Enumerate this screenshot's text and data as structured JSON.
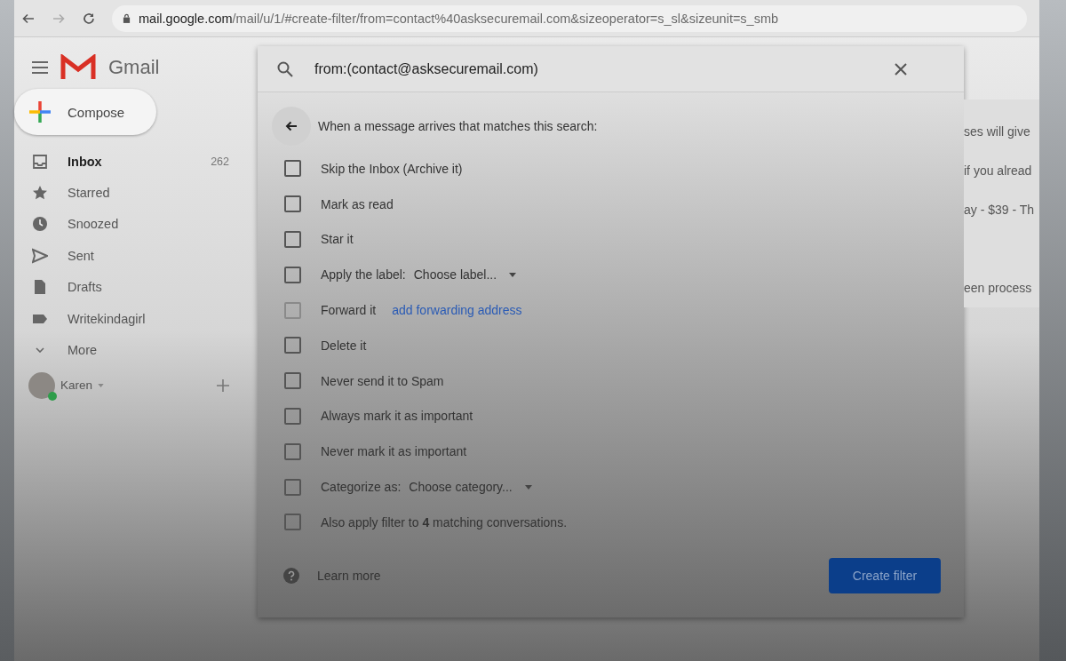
{
  "browser": {
    "url_host": "mail.google.com",
    "url_path": "/mail/u/1/#create-filter/from=contact%40asksecuremail.com&sizeoperator=s_sl&sizeunit=s_smb"
  },
  "header": {
    "app_name": "Gmail"
  },
  "search": {
    "value": "from:(contact@asksecuremail.com)"
  },
  "sidebar": {
    "compose": "Compose",
    "items": [
      {
        "label": "Inbox",
        "count": "262",
        "selected": true
      },
      {
        "label": "Starred",
        "selected": false
      },
      {
        "label": "Snoozed",
        "selected": false
      },
      {
        "label": "Sent",
        "selected": false
      },
      {
        "label": "Drafts",
        "selected": false
      },
      {
        "label": "Writekindagirl",
        "selected": false
      },
      {
        "label": "More",
        "selected": false
      }
    ],
    "account": {
      "name": "Karen"
    }
  },
  "background_snippets": [
    "ses will give",
    "if you alread",
    "ay - $39 - Th",
    "een process"
  ],
  "filter": {
    "heading": "When a message arrives that matches this search:",
    "options": [
      {
        "kind": "plain",
        "label": "Skip the Inbox (Archive it)",
        "checked": false,
        "disabled": false
      },
      {
        "kind": "plain",
        "label": "Mark as read",
        "checked": false,
        "disabled": false
      },
      {
        "kind": "plain",
        "label": "Star it",
        "checked": false,
        "disabled": false
      },
      {
        "kind": "dropdown",
        "label": "Apply the label:",
        "value": "Choose label...",
        "checked": false,
        "disabled": false
      },
      {
        "kind": "link",
        "label": "Forward it",
        "link": "add forwarding address",
        "checked": false,
        "disabled": true
      },
      {
        "kind": "plain",
        "label": "Delete it",
        "checked": false,
        "disabled": false
      },
      {
        "kind": "plain",
        "label": "Never send it to Spam",
        "checked": false,
        "disabled": false
      },
      {
        "kind": "plain",
        "label": "Always mark it as important",
        "checked": false,
        "disabled": false
      },
      {
        "kind": "plain",
        "label": "Never mark it as important",
        "checked": false,
        "disabled": false
      },
      {
        "kind": "dropdown",
        "label": "Categorize as:",
        "value": "Choose category...",
        "checked": false,
        "disabled": false
      },
      {
        "kind": "plain",
        "label": "Also apply filter to **4** matching conversations.",
        "checked": false,
        "disabled": false
      }
    ],
    "learn_more": "Learn more",
    "create_button": "Create filter"
  }
}
